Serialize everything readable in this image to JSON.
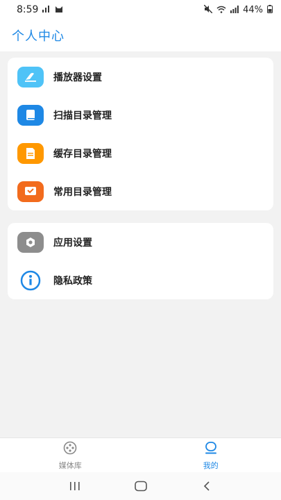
{
  "status_bar": {
    "time": "8:59",
    "battery": "44%",
    "icons": [
      "signal-icon",
      "cat-icon",
      "mute-icon",
      "wifi-icon",
      "cell-signal-icon",
      "battery-icon"
    ]
  },
  "header": {
    "title": "个人中心"
  },
  "menu_group_1": {
    "items": [
      {
        "label": "播放器设置",
        "icon": "player-settings-icon",
        "color": "#4fc3f7"
      },
      {
        "label": "扫描目录管理",
        "icon": "book-icon",
        "color": "#1e88e5"
      },
      {
        "label": "缓存目录管理",
        "icon": "document-icon",
        "color": "#ff9800"
      },
      {
        "label": "常用目录管理",
        "icon": "chat-check-icon",
        "color": "#f26b1d"
      }
    ]
  },
  "menu_group_2": {
    "items": [
      {
        "label": "应用设置",
        "icon": "settings-hex-icon",
        "color": "#8d8d8d"
      },
      {
        "label": "隐私政策",
        "icon": "info-icon",
        "color": "#1e88e5"
      }
    ]
  },
  "bottom_nav": {
    "items": [
      {
        "label": "媒体库",
        "icon": "film-reel-icon",
        "active": false
      },
      {
        "label": "我的",
        "icon": "profile-icon",
        "active": true
      }
    ],
    "active_color": "#1e88e5",
    "inactive_color": "#888888"
  },
  "system_nav": {
    "icons": [
      "recents-icon",
      "home-icon",
      "back-icon"
    ]
  }
}
